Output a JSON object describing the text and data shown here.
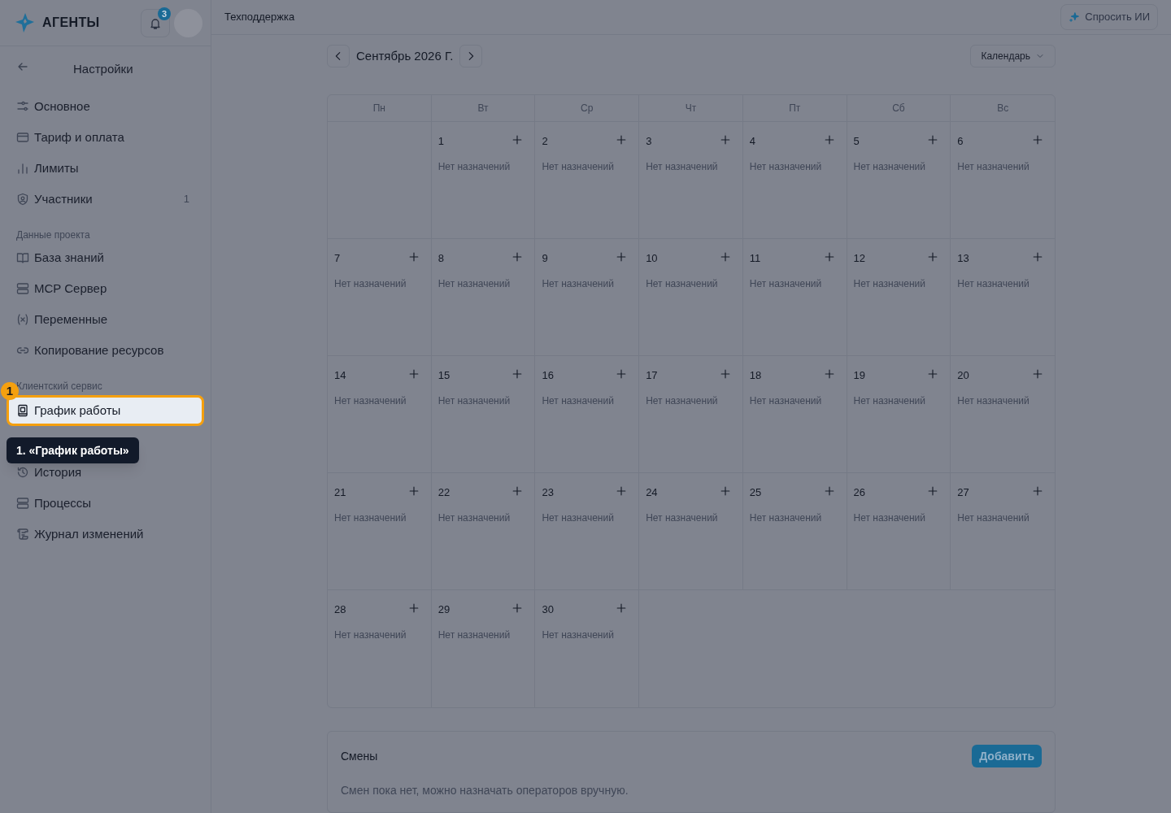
{
  "header": {
    "logo": "АГЕНТЫ",
    "notifications": "3",
    "breadcrumb": "Техподдержка",
    "ask_ai": "Спросить ИИ"
  },
  "sidebar": {
    "title": "Настройки",
    "groups": [
      {
        "items": [
          {
            "label": "Основное",
            "selected": false
          },
          {
            "label": "Тариф и оплата",
            "selected": false
          },
          {
            "label": "Лимиты",
            "selected": false
          },
          {
            "label": "Участники",
            "selected": false,
            "count": "1"
          }
        ]
      },
      {
        "heading": "Данные проекта",
        "items": [
          {
            "label": "База знаний",
            "selected": false
          },
          {
            "label": "MCP Сервер",
            "selected": false
          },
          {
            "label": "Переменные",
            "selected": false
          },
          {
            "label": "Копирование ресурсов",
            "selected": false
          }
        ]
      },
      {
        "heading": "Клиентский сервис",
        "items": [
          {
            "label": "График работы",
            "selected": true
          },
          {
            "label": "История",
            "selected": false
          },
          {
            "label": "Процессы",
            "selected": false
          },
          {
            "label": "Журнал изменений",
            "selected": false
          }
        ]
      }
    ]
  },
  "calendar": {
    "month": "Сентябрь 2026 Г.",
    "view": "Календарь",
    "weekdays": [
      "Пн",
      "Вт",
      "Ср",
      "Чт",
      "Пт",
      "Сб",
      "Вс"
    ],
    "days": [
      {
        "kind": "blank"
      },
      {
        "kind": "day",
        "date": "1",
        "text": "Нет назначений"
      },
      {
        "kind": "day",
        "date": "2",
        "text": "Нет назначений"
      },
      {
        "kind": "day",
        "date": "3",
        "text": "Нет назначений"
      },
      {
        "kind": "day",
        "date": "4",
        "text": "Нет назначений"
      },
      {
        "kind": "day",
        "date": "5",
        "text": "Нет назначений"
      },
      {
        "kind": "day",
        "date": "6",
        "text": "Нет назначений"
      },
      {
        "kind": "day",
        "date": "7",
        "text": "Нет назначений"
      },
      {
        "kind": "day",
        "date": "8",
        "text": "Нет назначений"
      },
      {
        "kind": "day",
        "date": "9",
        "text": "Нет назначений"
      },
      {
        "kind": "day",
        "date": "10",
        "text": "Нет назначений"
      },
      {
        "kind": "day",
        "date": "11",
        "text": "Нет назначений"
      },
      {
        "kind": "day",
        "date": "12",
        "text": "Нет назначений"
      },
      {
        "kind": "day",
        "date": "13",
        "text": "Нет назначений"
      },
      {
        "kind": "day",
        "date": "14",
        "text": "Нет назначений"
      },
      {
        "kind": "day",
        "date": "15",
        "text": "Нет назначений"
      },
      {
        "kind": "day",
        "date": "16",
        "text": "Нет назначений"
      },
      {
        "kind": "day",
        "date": "17",
        "text": "Нет назначений"
      },
      {
        "kind": "day",
        "date": "18",
        "text": "Нет назначений"
      },
      {
        "kind": "day",
        "date": "19",
        "text": "Нет назначений"
      },
      {
        "kind": "day",
        "date": "20",
        "text": "Нет назначений"
      },
      {
        "kind": "day",
        "date": "21",
        "text": "Нет назначений"
      },
      {
        "kind": "day",
        "date": "22",
        "text": "Нет назначений"
      },
      {
        "kind": "day",
        "date": "23",
        "text": "Нет назначений"
      },
      {
        "kind": "day",
        "date": "24",
        "text": "Нет назначений"
      },
      {
        "kind": "day",
        "date": "25",
        "text": "Нет назначений"
      },
      {
        "kind": "day",
        "date": "26",
        "text": "Нет назначений"
      },
      {
        "kind": "day",
        "date": "27",
        "text": "Нет назначений"
      },
      {
        "kind": "day",
        "date": "28",
        "text": "Нет назначений"
      },
      {
        "kind": "day",
        "date": "29",
        "text": "Нет назначений"
      },
      {
        "kind": "day",
        "date": "30",
        "text": "Нет назначений"
      }
    ]
  },
  "shifts": {
    "title": "Смены",
    "add": "Добавить",
    "empty": "Смен пока нет, можно назначать операторов вручную."
  },
  "tour": {
    "badge": "1",
    "tooltip": "1. «График работы»"
  }
}
